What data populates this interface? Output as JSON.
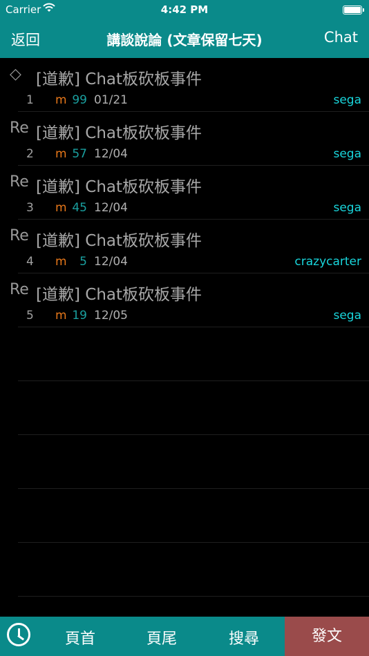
{
  "status": {
    "carrier": "Carrier",
    "time": "4:42 PM"
  },
  "nav": {
    "back": "返回",
    "title": "講談說論 (文章保留七天)",
    "board": "Chat"
  },
  "posts": [
    {
      "prefix": "◇",
      "subject": "[道歉] Chat板砍板事件",
      "num": "1",
      "mark": "m",
      "count": "99",
      "date": "01/21",
      "author": "sega"
    },
    {
      "prefix": "Re",
      "subject": "[道歉] Chat板砍板事件",
      "num": "2",
      "mark": "m",
      "count": "57",
      "date": "12/04",
      "author": "sega"
    },
    {
      "prefix": "Re",
      "subject": "[道歉] Chat板砍板事件",
      "num": "3",
      "mark": "m",
      "count": "45",
      "date": "12/04",
      "author": "sega"
    },
    {
      "prefix": "Re",
      "subject": "[道歉] Chat板砍板事件",
      "num": "4",
      "mark": "m",
      "count": "5",
      "date": "12/04",
      "author": "crazycarter"
    },
    {
      "prefix": "Re",
      "subject": "[道歉] Chat板砍板事件",
      "num": "5",
      "mark": "m",
      "count": "19",
      "date": "12/05",
      "author": "sega"
    }
  ],
  "toolbar": {
    "first": "頁首",
    "last": "頁尾",
    "search": "搜尋",
    "post": "發文"
  },
  "colors": {
    "accent": "#0a8a8a",
    "post_button": "#9a4b4b",
    "author": "#19d6dc",
    "mark": "#e8781a",
    "count": "#1aa0a0"
  },
  "icons": {
    "history": "clock-icon",
    "wifi": "wifi-icon",
    "battery": "battery-icon"
  }
}
